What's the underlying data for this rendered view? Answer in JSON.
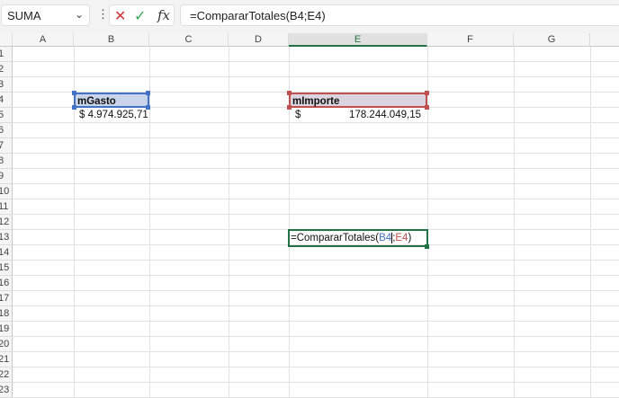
{
  "formula_bar": {
    "name_box": "SUMA",
    "cancel_icon": "✕",
    "enter_icon": "✓",
    "fx_label": "fx",
    "formula": "=CompararTotales(B4;E4)"
  },
  "columns": [
    "A",
    "B",
    "C",
    "D",
    "E",
    "F",
    "G"
  ],
  "rows": [
    "1",
    "2",
    "3",
    "4",
    "5",
    "6",
    "7",
    "8",
    "9",
    "10",
    "11",
    "12",
    "13",
    "14",
    "15",
    "16",
    "17",
    "18",
    "19",
    "20",
    "21",
    "22",
    "23"
  ],
  "cells": {
    "B4": "mGasto",
    "B5": "$ 4.974.925,71",
    "E4": "mImporte",
    "E5_symbol": "$",
    "E5_value": "178.244.049,15",
    "E13": {
      "prefix": "=CompararTotales(",
      "ref1": "B4",
      "sep": ";",
      "ref2": "E4",
      "suffix": ")"
    }
  },
  "colors": {
    "ref1": "#4472c4",
    "ref2": "#c0504d",
    "selection": "#217346"
  }
}
